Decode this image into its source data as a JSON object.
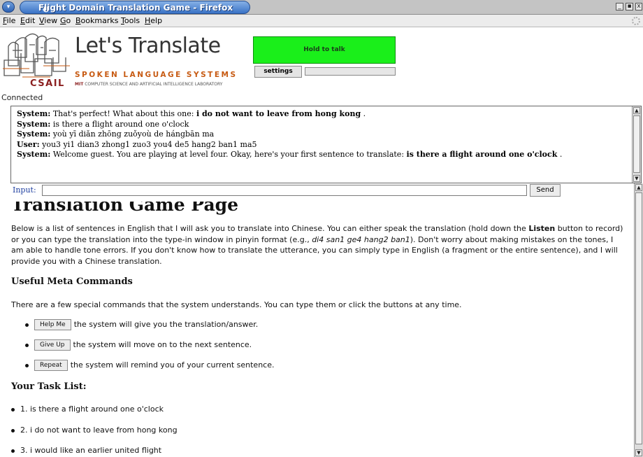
{
  "window": {
    "title": "Flight Domain Translation Game - Firefox",
    "menu_icon": "chevron-down-icon",
    "controls": [
      "minimize-icon",
      "maximize-icon",
      "close-icon"
    ]
  },
  "menubar": {
    "items": [
      {
        "label": "File",
        "underline": "F",
        "rest": "ile"
      },
      {
        "label": "Edit",
        "underline": "E",
        "rest": "dit"
      },
      {
        "label": "View",
        "underline": "V",
        "rest": "iew"
      },
      {
        "label": "Go",
        "underline": "G",
        "rest": "o"
      },
      {
        "label": "Bookmarks",
        "underline": "B",
        "rest": "ookmarks"
      },
      {
        "label": "Tools",
        "underline": "T",
        "rest": "ools"
      },
      {
        "label": "Help",
        "underline": "H",
        "rest": "elp"
      }
    ]
  },
  "logo": {
    "title": "Let's Translate",
    "subtitle": "SPOKEN LANGUAGE SYSTEMS",
    "org": "CSAIL",
    "lab_prefix": "MIT",
    "lab": "COMPUTER SCIENCE AND ARTIFICIAL INTELLIGENCE LABORATORY"
  },
  "applet": {
    "talk_label": "Hold to talk",
    "talk_color": "#1aef1a",
    "settings_label": "settings",
    "level": 0
  },
  "status": "Connected",
  "log": {
    "lines": [
      {
        "speaker": "System:",
        "text": "That's perfect! What about this one: ",
        "emph": "i do not want to leave from hong kong",
        "tail": " ."
      },
      {
        "speaker": "System:",
        "text": "is there a flight around one o'clock",
        "emph": "",
        "tail": ""
      },
      {
        "speaker": "System:",
        "text": "yoù yī diǎn zhōng zuǒyoù de hángbān ma",
        "emph": "",
        "tail": ""
      },
      {
        "speaker": "User:",
        "text": "you3 yi1 dian3 zhong1 zuo3 you4 de5 hang2 ban1 ma5",
        "emph": "",
        "tail": ""
      },
      {
        "speaker": "System:",
        "text": "Welcome guest. You are playing at level four. Okay, here's your first sentence to translate: ",
        "emph": "is there a flight around one o'clock",
        "tail": " ."
      }
    ]
  },
  "input": {
    "label": "Input:",
    "value": "",
    "send_label": "Send"
  },
  "page": {
    "title": "Translation Game Page",
    "intro_1": "Below is a list of sentences in English that I will ask you to translate into Chinese. You can either speak the translation (hold down the ",
    "intro_listen": "Listen",
    "intro_2": " button to record) or you can type the translation into the type-in window in pinyin format (e.g., ",
    "intro_example": "di4 san1 ge4 hang2 ban1",
    "intro_3": "). Don't worry about making mistakes on the tones, I am able to handle tone errors. If you don't know how to translate the utterance, you can simply type in English (a fragment or the entire sentence), and I will provide you with a Chinese translation.",
    "meta_heading": "Useful Meta Commands",
    "meta_intro": "There are a few special commands that the system understands. You can type them or click the buttons at any time.",
    "commands": [
      {
        "button": "Help Me",
        "desc": "the system will give you the translation/answer."
      },
      {
        "button": "Give Up",
        "desc": "the system will move on to the next sentence."
      },
      {
        "button": "Repeat",
        "desc": "the system will remind you of your current sentence."
      }
    ],
    "task_heading": "Your Task List:",
    "tasks": [
      "1. is there a flight around one o'clock",
      "2. i do not want to leave from hong kong",
      "3. i would like an earlier united flight"
    ]
  }
}
